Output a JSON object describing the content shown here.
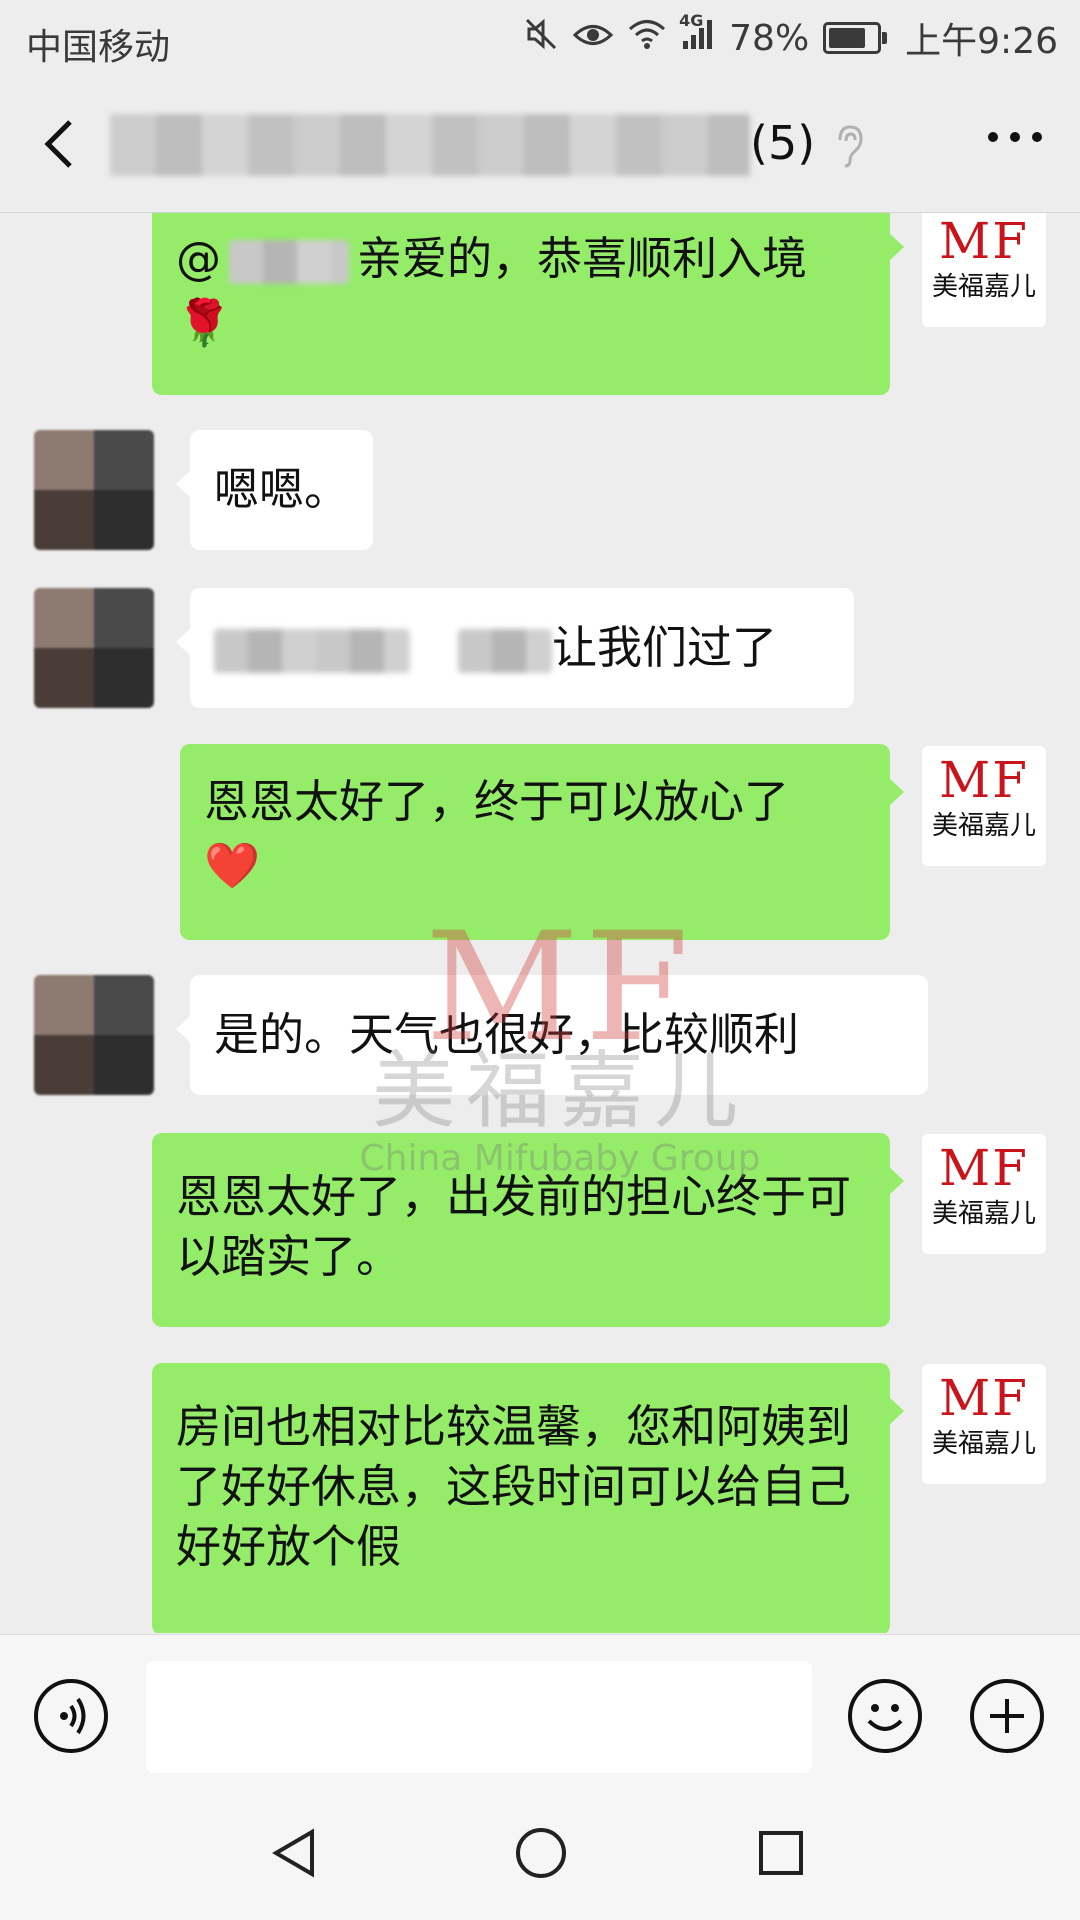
{
  "status_bar": {
    "carrier": "中国移动",
    "network": "4G",
    "battery_percent": "78%",
    "battery_level": 0.78,
    "time": "上午9:26"
  },
  "header": {
    "member_count": "(5)"
  },
  "messages": [
    {
      "side": "me",
      "mention": "@",
      "text": "亲爱的，恭喜顺利入境",
      "emoji": "🌹"
    },
    {
      "side": "them",
      "text": "嗯嗯。"
    },
    {
      "side": "them",
      "text": "让我们过了"
    },
    {
      "side": "me",
      "text": "恩恩太好了，终于可以放心了",
      "emoji": "❤️"
    },
    {
      "side": "them",
      "text": "是的。天气也很好，比较顺利"
    },
    {
      "side": "me",
      "text": "恩恩太好了，出发前的担心终于可以踏实了。"
    },
    {
      "side": "me",
      "text": "房间也相对比较温馨，您和阿姨到了好好休息，这段时间可以给自己好好放个假"
    }
  ],
  "avatar_brand": {
    "logo": "MF",
    "name": "美福嘉儿"
  },
  "watermark": {
    "logo": "MF",
    "name": "美福嘉儿",
    "english": "China Mifubaby Group"
  },
  "colors": {
    "my_bubble": "#95ec69",
    "their_bubble": "#ffffff",
    "background": "#ededed",
    "brand_red": "#c9141b"
  }
}
